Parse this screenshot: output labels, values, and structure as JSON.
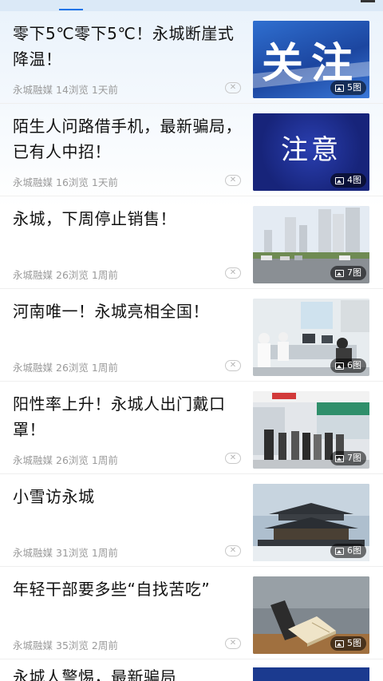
{
  "colors": {
    "accent": "#1a73e8",
    "meta": "#9a9a9a"
  },
  "articles": [
    {
      "title": "零下5℃零下5℃！永城断崖式降温！",
      "source": "永城融媒",
      "views": "14浏览",
      "time": "1天前",
      "img_count": "5图",
      "thumb_text": "关注"
    },
    {
      "title": "陌生人问路借手机，最新骗局，已有人中招！",
      "source": "永城融媒",
      "views": "16浏览",
      "time": "1天前",
      "img_count": "4图",
      "thumb_text": "注意"
    },
    {
      "title": "永城，下周停止销售！",
      "source": "永城融媒",
      "views": "26浏览",
      "time": "1周前",
      "img_count": "7图"
    },
    {
      "title": "河南唯一！永城亮相全国！",
      "source": "永城融媒",
      "views": "26浏览",
      "time": "1周前",
      "img_count": "6图"
    },
    {
      "title": "阳性率上升！永城人出门戴口罩！",
      "source": "永城融媒",
      "views": "26浏览",
      "time": "1周前",
      "img_count": "7图"
    },
    {
      "title": "小雪访永城",
      "source": "永城融媒",
      "views": "31浏览",
      "time": "1周前",
      "img_count": "6图"
    },
    {
      "title": "年轻干部要多些“自找苦吃”",
      "source": "永城融媒",
      "views": "35浏览",
      "time": "2周前",
      "img_count": "5图"
    },
    {
      "title": "永城人警惕，最新骗局"
    }
  ],
  "close_symbol": "✕"
}
